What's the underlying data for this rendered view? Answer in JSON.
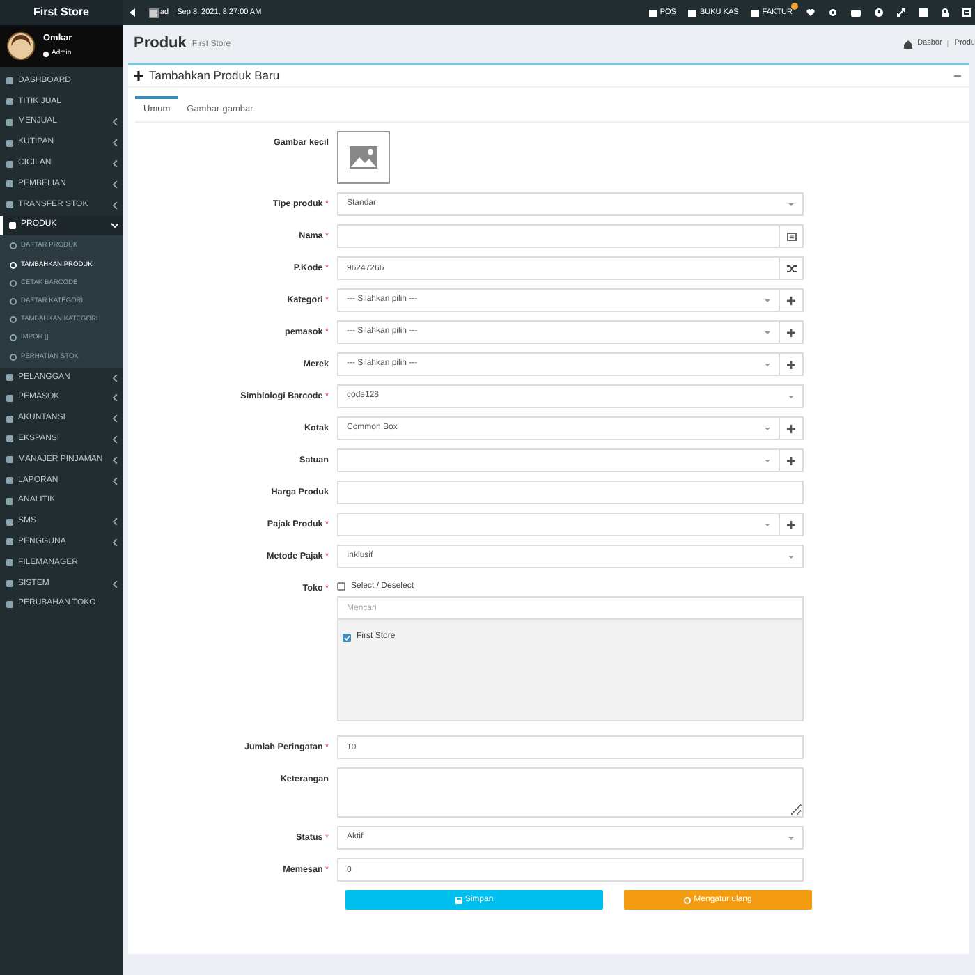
{
  "app": {
    "title": "First Store"
  },
  "topbar": {
    "logo_alt": "ad",
    "datetime": "Sep 8, 2021, 8:27:00 AM",
    "links": [
      {
        "label": "POS",
        "badge": false
      },
      {
        "label": "BUKU KAS",
        "badge": false
      },
      {
        "label": "FAKTUR",
        "badge": true
      }
    ]
  },
  "user": {
    "name": "Omkar",
    "role": "Admin",
    "online": true
  },
  "sidebar": {
    "items": [
      {
        "label": "DASHBOARD",
        "selected": false,
        "expandable": false
      },
      {
        "label": "TITIK JUAL",
        "selected": false,
        "expandable": false
      },
      {
        "label": "MENJUAL",
        "selected": false,
        "expandable": true
      },
      {
        "label": "KUTIPAN",
        "selected": false,
        "expandable": true
      },
      {
        "label": "CICILAN",
        "selected": false,
        "expandable": true
      },
      {
        "label": "PEMBELIAN",
        "selected": false,
        "expandable": true
      },
      {
        "label": "TRANSFER STOK",
        "selected": false,
        "expandable": true
      },
      {
        "label": "PRODUK",
        "selected": true,
        "expandable": true,
        "expanded": true,
        "children": [
          {
            "label": "DAFTAR PRODUK",
            "selected": false
          },
          {
            "label": "TAMBAHKAN PRODUK",
            "selected": true
          },
          {
            "label": "CETAK BARCODE",
            "selected": false
          },
          {
            "label": "DAFTAR KATEGORI",
            "selected": false
          },
          {
            "label": "TAMBAHKAN KATEGORI",
            "selected": false
          },
          {
            "label": "IMPOR []",
            "selected": false
          },
          {
            "label": "PERHATIAN STOK",
            "selected": false
          }
        ]
      },
      {
        "label": "PELANGGAN",
        "selected": false,
        "expandable": true
      },
      {
        "label": "PEMASOK",
        "selected": false,
        "expandable": true
      },
      {
        "label": "AKUNTANSI",
        "selected": false,
        "expandable": true
      },
      {
        "label": "EKSPANSI",
        "selected": false,
        "expandable": true
      },
      {
        "label": "MANAJER PINJAMAN",
        "selected": false,
        "expandable": true
      },
      {
        "label": "LAPORAN",
        "selected": false,
        "expandable": true
      },
      {
        "label": "ANALITIK",
        "selected": false,
        "expandable": false
      },
      {
        "label": "SMS",
        "selected": false,
        "expandable": true
      },
      {
        "label": "PENGGUNA",
        "selected": false,
        "expandable": true
      },
      {
        "label": "FILEMANAGER",
        "selected": false,
        "expandable": false
      },
      {
        "label": "SISTEM",
        "selected": false,
        "expandable": true
      },
      {
        "label": "PERUBAHAN TOKO",
        "selected": false,
        "expandable": false
      }
    ]
  },
  "page": {
    "title": "Produk",
    "subtitle": "First Store",
    "breadcrumb": [
      "Dasbor",
      "Produ"
    ]
  },
  "box": {
    "title": "Tambahkan Produk Baru"
  },
  "tabs": [
    {
      "label": "Umum",
      "selected": true
    },
    {
      "label": "Gambar-gambar",
      "selected": false
    }
  ],
  "form": {
    "fields": [
      {
        "kind": "image",
        "label": "Gambar kecil"
      },
      {
        "kind": "select",
        "label": "Tipe produk",
        "required_mark": "*",
        "value": "Standar",
        "add": false
      },
      {
        "kind": "text",
        "label": "Nama",
        "required_mark": "*",
        "addon": {
          "kind": "card"
        }
      },
      {
        "kind": "text",
        "label": "P.Kode",
        "required_mark": "*",
        "value": "96247266",
        "addon": {
          "kind": "shuffle"
        }
      },
      {
        "kind": "select",
        "label": "Kategori",
        "required_mark": "*",
        "value": "--- Silahkan pilih ---",
        "add": true
      },
      {
        "kind": "select",
        "label": "pemasok",
        "required_mark": "*",
        "value": "--- Silahkan pilih ---",
        "add": true
      },
      {
        "kind": "select",
        "label": "Merek",
        "value": "--- Silahkan pilih ---",
        "add": true
      },
      {
        "kind": "select",
        "label": "Simbiologi Barcode",
        "required_mark": "*",
        "value": "code128",
        "add": false
      },
      {
        "kind": "select",
        "label": "Kotak",
        "value": "Common Box",
        "add": true
      },
      {
        "kind": "select",
        "label": "Satuan",
        "add": true
      },
      {
        "kind": "text",
        "label": "Harga Produk"
      },
      {
        "kind": "select",
        "label": "Pajak Produk",
        "required_mark": "*",
        "add": true
      },
      {
        "kind": "select",
        "label": "Metode Pajak",
        "required_mark": "*",
        "value": "Inklusif",
        "add": false
      },
      {
        "kind": "stores",
        "label": "Toko",
        "required_mark": "*",
        "select_all": {
          "label": "Select / Deselect",
          "checked": false
        },
        "search": {
          "placeholder": "Mencari"
        },
        "options": [
          {
            "label": "First Store",
            "checked": true
          }
        ]
      },
      {
        "kind": "text",
        "label": "Jumlah Peringatan",
        "required_mark": "*",
        "value": "10"
      },
      {
        "kind": "textarea",
        "label": "Keterangan"
      },
      {
        "kind": "select",
        "label": "Status",
        "required_mark": "*",
        "value": "Aktif",
        "add": false
      },
      {
        "kind": "text",
        "label": "Memesan",
        "required_mark": "*",
        "value": "0"
      }
    ]
  },
  "buttons": [
    {
      "kind": "save",
      "label": "Simpan"
    },
    {
      "kind": "reset",
      "label": "Mengatur ulang"
    }
  ]
}
